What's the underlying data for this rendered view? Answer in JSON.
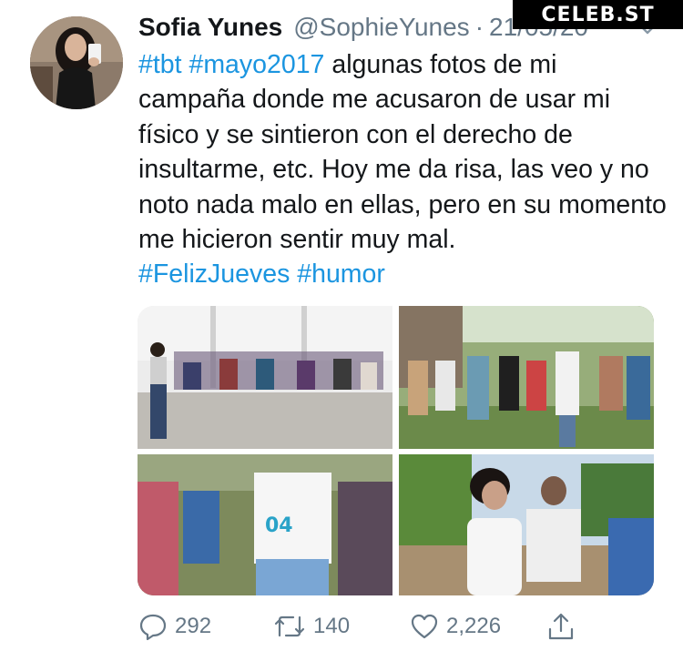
{
  "watermark": {
    "text": "CELEB.ST"
  },
  "author": {
    "name": "Sofia Yunes",
    "handle": "@SophieYunes",
    "separator": "·",
    "date": "21/05/20"
  },
  "tweet": {
    "hashtag_tbt": "#tbt",
    "hashtag_mayo": "#mayo2017",
    "body": " algunas fotos de mi campaña donde me acusaron de usar mi físico y se sintieron con el derecho de insultarme, etc. Hoy me da risa, las veo y no noto nada malo en ellas, pero en su momento me hicieron sentir muy mal.",
    "hashtag_feliz": "#FelizJueves",
    "hashtag_humor": "#humor"
  },
  "actions": {
    "replies": "292",
    "retweets": "140",
    "likes": "2,226"
  },
  "icons": {
    "reply": "reply-icon",
    "retweet": "retweet-icon",
    "like": "heart-icon",
    "share": "share-icon",
    "more": "chevron-down-icon"
  },
  "colors": {
    "link": "#1b95e0",
    "muted": "#657786",
    "text": "#14171a"
  }
}
